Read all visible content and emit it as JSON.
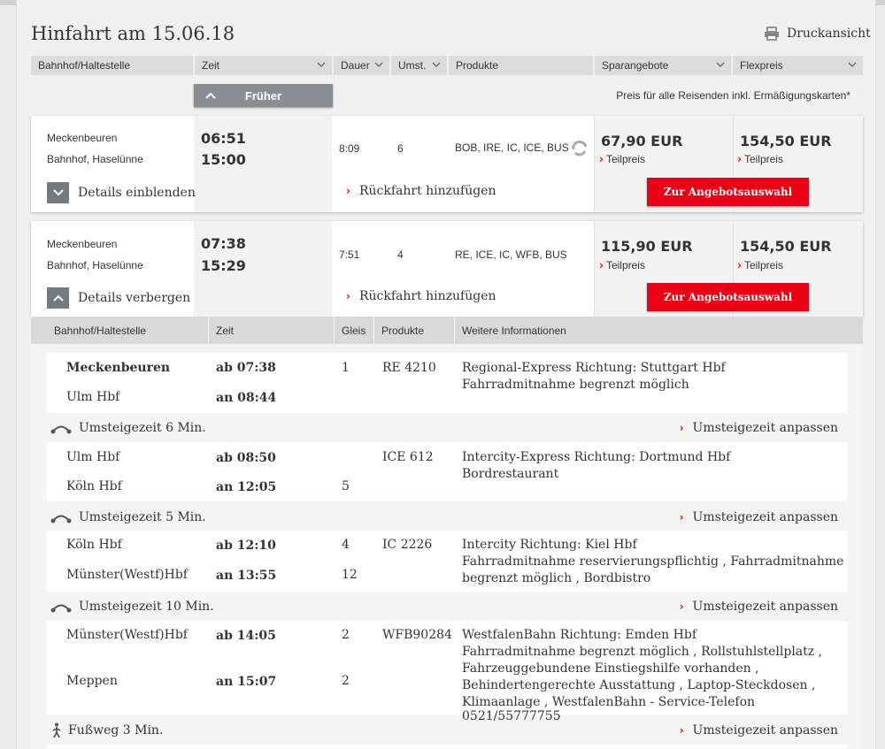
{
  "title": "Hinfahrt am 15.06.18",
  "print_label": "Druckansicht",
  "columns": [
    "Bahnhof/Haltestelle",
    "Zeit",
    "Dauer",
    "Umst.",
    "Produkte",
    "Sparangebote",
    "Flexpreis"
  ],
  "frueher_label": "Früher",
  "price_note": "Preis für alle Reisenden inkl. Ermäßigungskarten*",
  "connections": [
    {
      "from": "Meckenbeuren",
      "to": "Bahnhof, Haselünne",
      "dep": "06:51",
      "arr": "15:00",
      "duration": "8:09",
      "changes": "6",
      "products": "BOB, IRE, IC, ICE, BUS",
      "spar_price": "67,90 EUR",
      "flex_price": "154,50 EUR",
      "teilpreis": "Teilpreis",
      "toggle_label": "Details einblenden",
      "rueck_label": "Rückfahrt hinzufügen",
      "offer_button": "Zur Angebotsauswahl"
    },
    {
      "from": "Meckenbeuren",
      "to": "Bahnhof, Haselünne",
      "dep": "07:38",
      "arr": "15:29",
      "duration": "7:51",
      "changes": "4",
      "products": "RE, ICE, IC, WFB, BUS",
      "spar_price": "115,90 EUR",
      "flex_price": "154,50 EUR",
      "teilpreis": "Teilpreis",
      "toggle_label": "Details verbergen",
      "rueck_label": "Rückfahrt hinzufügen",
      "offer_button": "Zur Angebotsauswahl"
    }
  ],
  "detail_columns": [
    "Bahnhof/Haltestelle",
    "Zeit",
    "Gleis",
    "Produkte",
    "Weitere Informationen"
  ],
  "segments": [
    {
      "from": "Meckenbeuren",
      "dep": "ab 07:38",
      "gleis_dep": "1",
      "to": "Ulm Hbf",
      "arr": "an 08:44",
      "gleis_arr": "",
      "product": "RE 4210",
      "info": [
        "Regional-Express Richtung: Stuttgart Hbf",
        "Fahrradmitnahme begrenzt möglich"
      ]
    },
    {
      "from": "Ulm Hbf",
      "dep": "ab 08:50",
      "gleis_dep": "",
      "to": "Köln Hbf",
      "arr": "an 12:05",
      "gleis_arr": "5",
      "product": "ICE 612",
      "info": [
        "Intercity-Express Richtung: Dortmund Hbf",
        "Bordrestaurant"
      ]
    },
    {
      "from": "Köln Hbf",
      "dep": "ab 12:10",
      "gleis_dep": "4",
      "to": "Münster(Westf)Hbf",
      "arr": "an 13:55",
      "gleis_arr": "12",
      "product": "IC 2226",
      "info": [
        "Intercity Richtung: Kiel Hbf",
        "Fahrradmitnahme reservierungspflichtig , Fahrradmitnahme",
        "begrenzt möglich , Bordbistro"
      ]
    },
    {
      "from": "Münster(Westf)Hbf",
      "dep": "ab 14:05",
      "gleis_dep": "2",
      "to": "Meppen",
      "arr": "an 15:07",
      "gleis_arr": "2",
      "product": "WFB90284",
      "info": [
        "WestfalenBahn Richtung: Emden Hbf",
        "Fahrradmitnahme begrenzt möglich , Rollstuhlstellplatz ,",
        "Fahrzeuggebundene Einstiegshilfe vorhanden ,",
        "Behindertengerechte Ausstattung , Laptop-Steckdosen ,",
        "Klimaanlage , WestfalenBahn - Service-Telefon 0521/55777755"
      ]
    }
  ],
  "transfers": [
    {
      "label": "Umsteigezeit 6 Min.",
      "adjust": "Umsteigezeit anpassen"
    },
    {
      "label": "Umsteigezeit 5 Min.",
      "adjust": "Umsteigezeit anpassen"
    },
    {
      "label": "Umsteigezeit 10 Min.",
      "adjust": "Umsteigezeit anpassen"
    },
    {
      "label": "Fußweg 3 Min.",
      "adjust": "Umsteigezeit anpassen"
    }
  ],
  "colors": {
    "accent_red": "#ec0016",
    "chevron_red": "#ee0000",
    "toggle_grey": "#727b82"
  },
  "icons": [
    "printer-icon",
    "chevron-down-icon",
    "chevron-up-icon",
    "chevron-right-icon",
    "transfer-icon",
    "walk-icon",
    "bus-connection-icon"
  ]
}
